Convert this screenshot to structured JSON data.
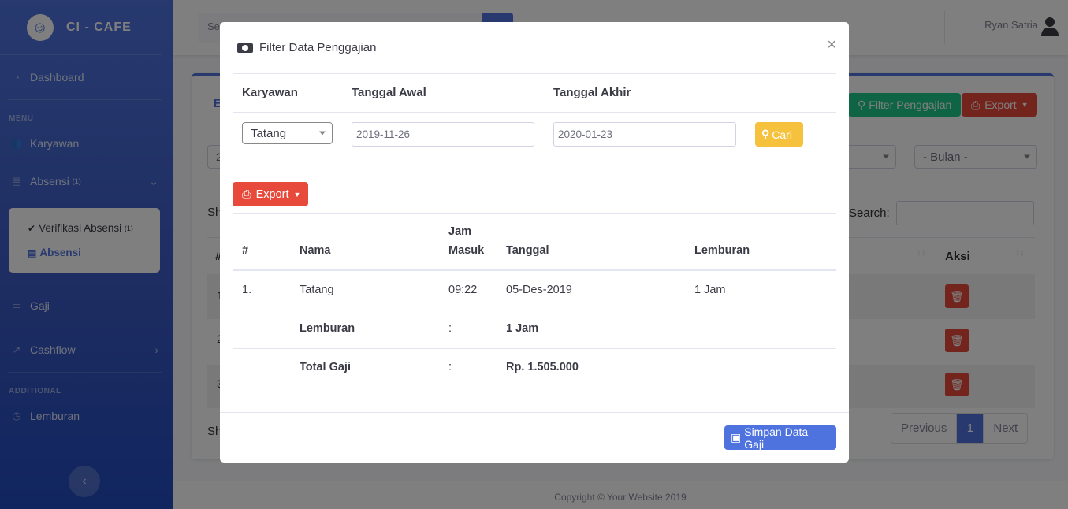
{
  "sidebar": {
    "brand": "CI - CAFE",
    "dashboard": "Dashboard",
    "heading_menu": "MENU",
    "karyawan": "Karyawan",
    "absensi": "Absensi",
    "absensi_badge": "(1)",
    "verifikasi": "Verifikasi Absensi",
    "verifikasi_badge": "(1)",
    "absensi_sub": "Absensi",
    "gaji": "Gaji",
    "cashflow": "Cashflow",
    "heading_additional": "ADDITIONAL",
    "lembur": "Lemburan"
  },
  "topbar": {
    "search_placeholder": "Se",
    "user_name": "Ryan Satria"
  },
  "background_card": {
    "title_initial": "E",
    "filter_button": "Filter Penggajian",
    "export_button": "Export",
    "year_select_initial": "2",
    "month_select": "- Bulan -",
    "show_initial": "Sh",
    "search_label": "Search:",
    "col_initial": "#",
    "col_aksi": "Aksi",
    "row_numbers": [
      "1",
      "2",
      "3"
    ],
    "footer_initial": "Sh",
    "pagination": {
      "previous": "Previous",
      "current": "1",
      "next": "Next"
    }
  },
  "footer": {
    "text": "Copyright © Your Website 2019"
  },
  "modal": {
    "title": "Filter Data Penggajian",
    "close": "×",
    "filter": {
      "karyawan_label": "Karyawan",
      "karyawan_value": "Tatang",
      "tanggal_awal_label": "Tanggal Awal",
      "tanggal_awal_value": "2019-11-26",
      "tanggal_akhir_label": "Tanggal Akhir",
      "tanggal_akhir_value": "2020-01-23",
      "cari_button": "Cari"
    },
    "export_button": "Export",
    "table": {
      "headers": {
        "no": "#",
        "nama": "Nama",
        "jam_masuk_1": "Jam",
        "jam_masuk_2": "Masuk",
        "tanggal": "Tanggal",
        "lembur": "Lemburan"
      },
      "row": {
        "no": "1.",
        "nama": "Tatang",
        "jam_masuk": "09:22",
        "tanggal": "05-Des-2019",
        "lembur": "1 Jam"
      },
      "summary_lembur": {
        "label": "Lemburan",
        "sep": ":",
        "value": "1 Jam"
      },
      "summary_total": {
        "label": "Total Gaji",
        "sep": ":",
        "value": "Rp. 1.505.000"
      }
    },
    "save_button": "Simpan Data Gaji"
  }
}
